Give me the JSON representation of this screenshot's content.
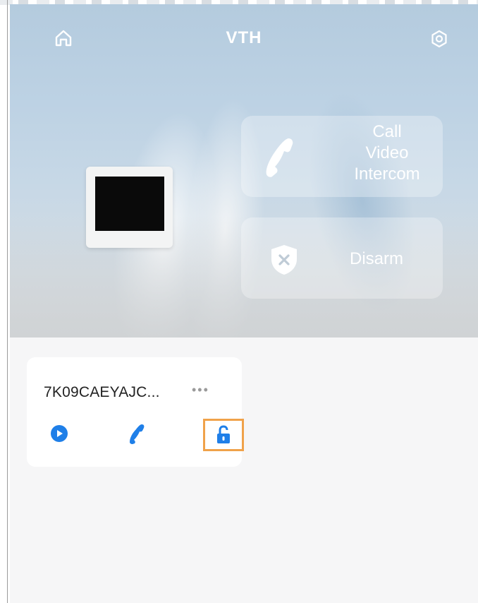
{
  "header": {
    "title": "VTH"
  },
  "actions": {
    "call_lines": [
      "Call",
      "Video",
      "Intercom"
    ],
    "disarm_label": "Disarm"
  },
  "device": {
    "name": "7K09CAEYAJC...",
    "more_label": "•••"
  },
  "icons": {
    "home": "home-icon",
    "settings": "settings-icon",
    "call": "phone-icon",
    "disarm": "shield-x-icon",
    "play": "play-icon",
    "device_call": "phone-icon",
    "unlock": "unlock-icon"
  },
  "colors": {
    "accent": "#1f7fe8",
    "highlight": "#f0a24a"
  }
}
